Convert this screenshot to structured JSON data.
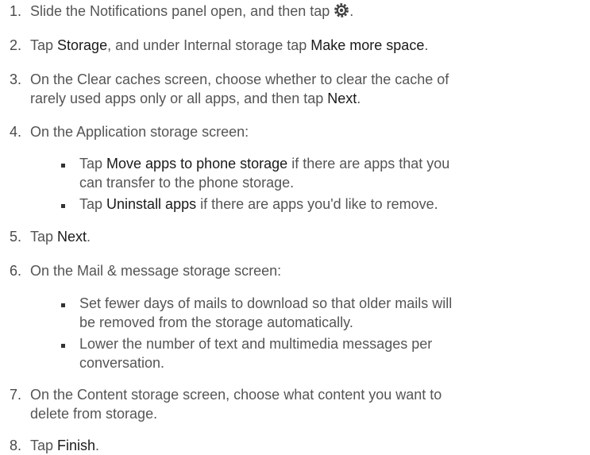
{
  "steps": [
    {
      "num": "1.",
      "lines": [
        [
          "Slide the Notifications panel open, and then tap ",
          "",
          "."
        ]
      ]
    },
    {
      "num": "2.",
      "parts": [
        "Tap ",
        "Storage",
        ", and under Internal storage tap ",
        "Make more space",
        "."
      ]
    },
    {
      "num": "3.",
      "line1": "On the Clear caches screen, choose whether to clear the cache of",
      "line2_a": "rarely used apps only or all apps, and then tap ",
      "line2_b": "Next",
      "line2_c": "."
    },
    {
      "num": "4.",
      "text": "On the Application storage screen:"
    },
    {
      "num": "5.",
      "a": "Tap ",
      "b": "Next",
      "c": "."
    },
    {
      "num": "6.",
      "text": "On the Mail & message storage screen:"
    },
    {
      "num": "7.",
      "line1": "On the Content storage screen, choose what content you want to",
      "line2": "delete from storage."
    },
    {
      "num": "8.",
      "a": "Tap ",
      "b": "Finish",
      "c": "."
    }
  ],
  "sub4": [
    {
      "l1a": "Tap ",
      "l1b": "Move apps to phone storage",
      "l1c": " if there are apps that you",
      "l2": "can transfer to the phone storage."
    },
    {
      "l1a": "Tap ",
      "l1b": "Uninstall apps",
      "l1c": " if there are apps you'd like to remove."
    }
  ],
  "sub6": [
    {
      "l1": "Set fewer days of mails to download so that older mails will",
      "l2": "be removed from the storage automatically."
    },
    {
      "l1": "Lower the number of text and multimedia messages per",
      "l2": "conversation."
    }
  ],
  "icons": {
    "settings": "gear-icon"
  }
}
